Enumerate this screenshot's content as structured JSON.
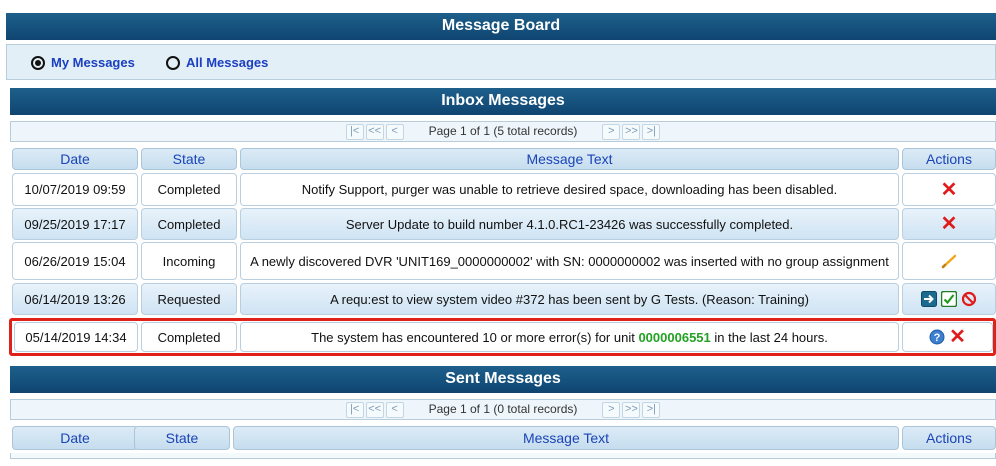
{
  "board_title": "Message Board",
  "filters": {
    "my_messages": "My Messages",
    "all_messages": "All Messages",
    "selected": "My Messages"
  },
  "inbox": {
    "title": "Inbox Messages",
    "pager_text": "Page 1 of 1 (5 total records)",
    "columns": {
      "date": "Date",
      "state": "State",
      "message": "Message Text",
      "actions": "Actions"
    },
    "rows": [
      {
        "date": "10/07/2019 09:59",
        "state": "Completed",
        "text": "Notify Support, purger was unable to retrieve desired space, downloading has been disabled.",
        "actions": [
          "delete-icon"
        ]
      },
      {
        "date": "09/25/2019 17:17",
        "state": "Completed",
        "text": "Server Update to build number 4.1.0.RC1-23426 was successfully completed.",
        "actions": [
          "delete-icon"
        ]
      },
      {
        "date": "06/26/2019 15:04",
        "state": "Incoming",
        "text": "A newly discovered DVR 'UNIT169_0000000002' with SN: 0000000002 was inserted with no group assignment",
        "actions": [
          "edit-pencil-icon"
        ]
      },
      {
        "date": "06/14/2019 13:26",
        "state": "Requested",
        "text": "A requ:est to view system video #372 has been sent by G Tests. (Reason: Training)",
        "actions": [
          "forward-arrow-icon",
          "approve-check-icon",
          "deny-circle-icon"
        ]
      },
      {
        "date": "05/14/2019 14:34",
        "state": "Completed",
        "text_before": "The system has encountered 10 or more error(s) for unit ",
        "text_unit": "0000006551",
        "text_after": " in the last 24 hours.",
        "actions": [
          "help-icon",
          "delete-icon"
        ]
      }
    ]
  },
  "sent": {
    "title": "Sent Messages",
    "pager_text": "Page 1 of 1 (0 total records)",
    "columns": {
      "date": "Date",
      "state": "State",
      "message": "Message Text",
      "actions": "Actions"
    }
  },
  "pager_buttons": {
    "first": "|<",
    "prev_many": "<<",
    "prev": "<",
    "next": ">",
    "next_many": ">>",
    "last": ">|"
  },
  "colors": {
    "accent": "#0f4570",
    "highlight": "#e0211a",
    "unit_green": "#23a123",
    "delete_red": "#e01b1b"
  }
}
